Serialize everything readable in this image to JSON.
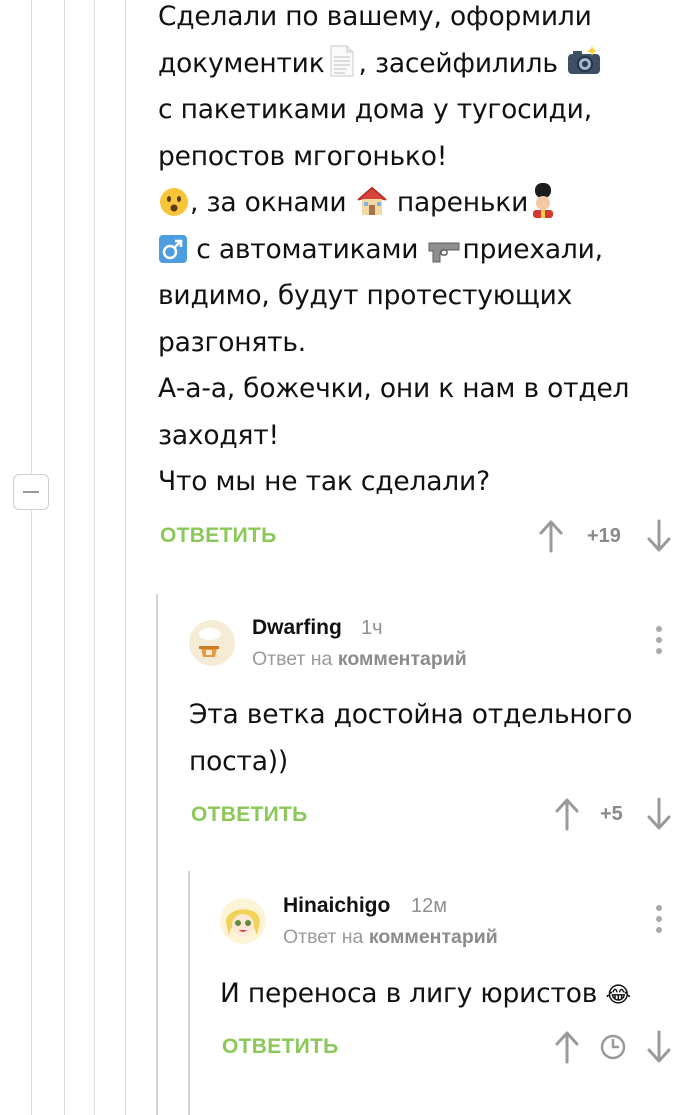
{
  "comment_main": {
    "lines": [
      "Сделали по вашему, оформили",
      "документик",
      ", засейфилиль",
      "с пакетиками дома у тугосиди,",
      "репостов мгогонько!",
      ", за окнами",
      "пареньки",
      "с автоматиками",
      "приехали,",
      "видимо, будут протестующих",
      "разгонять.",
      "А-а-а, божечки, они к нам в отдел",
      "заходят!",
      "Что мы не так сделали?"
    ],
    "reply_label": "ОТВЕТИТЬ",
    "score": "+19"
  },
  "comment_dwarfing": {
    "username": "Dwarfing",
    "time": "1ч",
    "sub_prefix": "Ответ на",
    "sub_link": "комментарий",
    "lines": [
      "Эта ветка достойна отдельного",
      "поста))"
    ],
    "reply_label": "ОТВЕТИТЬ",
    "score": "+5"
  },
  "comment_hinaichigo": {
    "username": "Hinaichigo",
    "time": "12м",
    "sub_prefix": "Ответ на",
    "sub_link": "комментарий",
    "lines": [
      "И переноса в лигу юристов",
      "😂"
    ],
    "reply_label": "ОТВЕТИТЬ"
  },
  "colors": {
    "reply_green": "#8ac858",
    "meta_gray": "#9a9a9a",
    "thread_line": "#d4d4d4"
  },
  "icons": [
    "document-emoji-icon",
    "camera-emoji-icon",
    "surprised-face-emoji-icon",
    "house-emoji-icon",
    "guardsman-emoji-icon",
    "male-sign-emoji-icon",
    "pistol-emoji-icon",
    "arrow-up-icon",
    "arrow-down-icon",
    "clock-icon",
    "more-vertical-icon",
    "collapse-minus-icon"
  ]
}
